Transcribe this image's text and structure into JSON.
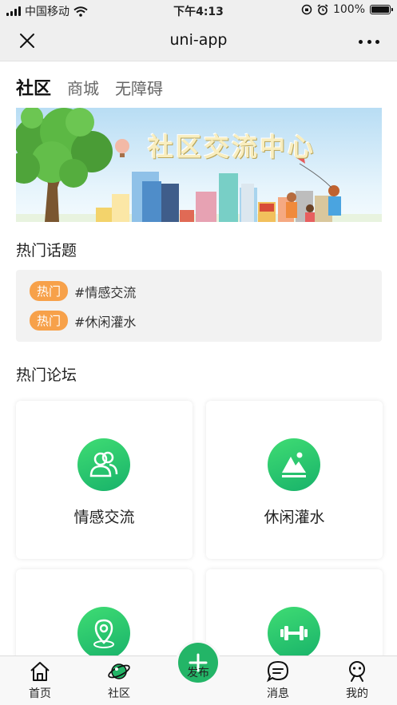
{
  "status_bar": {
    "carrier": "中国移动",
    "time": "下午4:13",
    "battery": "100%"
  },
  "nav": {
    "title": "uni-app"
  },
  "tabs": [
    "社区",
    "商城",
    "无障碍"
  ],
  "banner": {
    "title": "社区交流中心"
  },
  "hot_topics": {
    "title": "热门话题",
    "items": [
      {
        "badge": "热门",
        "text": "#情感交流"
      },
      {
        "badge": "热门",
        "text": "#休闲灌水"
      }
    ]
  },
  "hot_forums": {
    "title": "热门论坛",
    "cards": [
      {
        "label": "情感交流",
        "icon": "users-icon"
      },
      {
        "label": "休闲灌水",
        "icon": "mountain-icon"
      },
      {
        "label": "",
        "icon": "location-pin-icon"
      },
      {
        "label": "",
        "icon": "dumbbell-icon"
      }
    ]
  },
  "tabbar": {
    "items": [
      {
        "label": "首页",
        "icon": "home-icon"
      },
      {
        "label": "社区",
        "icon": "planet-icon"
      },
      {
        "label": "发布",
        "icon": "plus-icon"
      },
      {
        "label": "消息",
        "icon": "chat-icon"
      },
      {
        "label": "我的",
        "icon": "profile-icon"
      }
    ]
  },
  "colors": {
    "accent_green": "#23b567",
    "badge_orange": "#f7a14a"
  }
}
